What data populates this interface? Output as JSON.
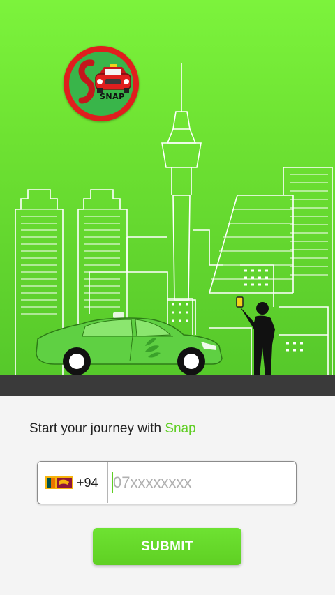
{
  "header": {
    "logo_icon": "snap-taxi-logo",
    "logo_text": "SNAP"
  },
  "hero": {
    "illustration": "city-skyline-with-taxi-and-person-hailing",
    "accent_color": "#6ee232"
  },
  "onboarding": {
    "tagline_prefix": "Start your journey with ",
    "tagline_brand": "Snap",
    "brand_color": "#5fce23"
  },
  "phone": {
    "flag_icon": "sri-lanka-flag-icon",
    "country_code": "+94",
    "placeholder": "07xxxxxxxx",
    "value": ""
  },
  "submit": {
    "label": "SUBMIT",
    "color": "#66d92b"
  }
}
